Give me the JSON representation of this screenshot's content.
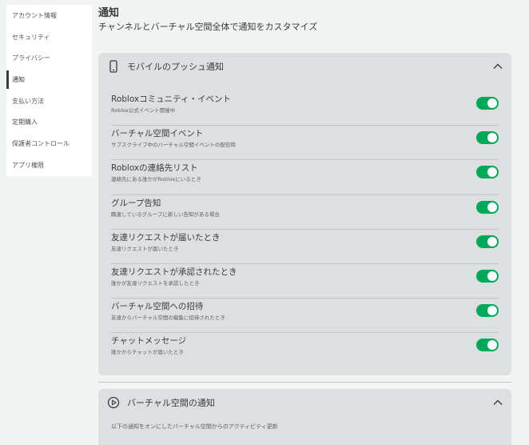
{
  "sidebar": {
    "items": [
      {
        "label": "アカウント情報"
      },
      {
        "label": "セキュリティ"
      },
      {
        "label": "プライバシー"
      },
      {
        "label": "通知"
      },
      {
        "label": "支払い方法"
      },
      {
        "label": "定期購入"
      },
      {
        "label": "保護者コントロール"
      },
      {
        "label": "アプリ権限"
      }
    ]
  },
  "header": {
    "title": "通知",
    "subtitle": "チャンネルとバーチャル空間全体で通知をカスタマイズ"
  },
  "mobile_panel": {
    "icon": "smartphone-icon",
    "title": "モバイルのプッシュ通知",
    "rows": [
      {
        "title": "Robloxコミュニティ・イベント",
        "desc": "Roblox公式イベント開催中",
        "enabled": true
      },
      {
        "title": "バーチャル空間イベント",
        "desc": "サブスクライブ中のバーチャル空間イベントの配信時",
        "enabled": true
      },
      {
        "title": "Robloxの連絡先リスト",
        "desc": "連絡先にある誰かがRobloxにいるとき",
        "enabled": true
      },
      {
        "title": "グループ告知",
        "desc": "職違しているグループに新しい告知がある場合",
        "enabled": true
      },
      {
        "title": "友達リクエストが届いたとき",
        "desc": "友達リクエストが届いたとき",
        "enabled": true
      },
      {
        "title": "友達リクエストが承認されたとき",
        "desc": "誰かが友達リクエストを承認したとき",
        "enabled": true
      },
      {
        "title": "バーチャル空間への招待",
        "desc": "友達からバーチャル空間の編集に招待されたとき",
        "enabled": true
      },
      {
        "title": "チャットメッセージ",
        "desc": "誰かからチャットが届いたとき",
        "enabled": true
      }
    ]
  },
  "vspace_panel": {
    "icon": "play-circle-icon",
    "title": "バーチャル空間の通知",
    "note": "以下の通知をオンにしたバーチャル空間からのアクティビティ更新"
  },
  "colors": {
    "toggle_on": "#00a95a",
    "panel_bg": "#dddfe1",
    "page_bg": "#f2f3f3"
  }
}
